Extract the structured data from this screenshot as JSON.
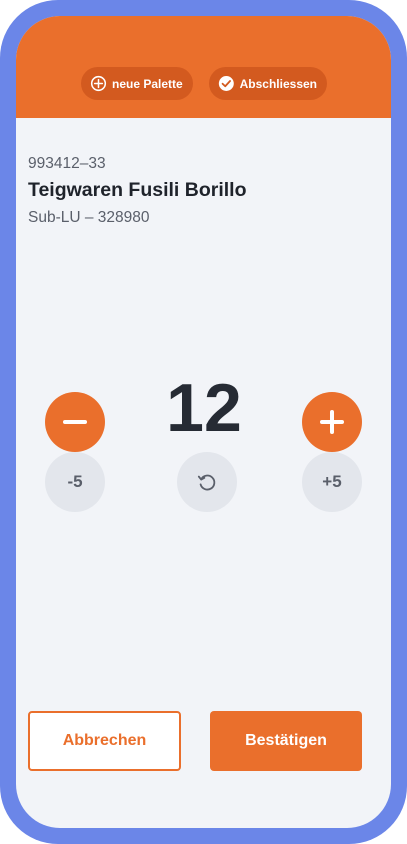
{
  "header": {
    "new_pallet_label": "neue Palette",
    "finish_label": "Abschliessen"
  },
  "article": {
    "code": "993412–33",
    "name": "Teigwaren Fusili Borillo",
    "sub_lu": "Sub-LU – 328980"
  },
  "counter": {
    "quantity": "12",
    "minus_five_label": "-5",
    "plus_five_label": "+5"
  },
  "actions": {
    "cancel_label": "Abbrechen",
    "confirm_label": "Bestätigen"
  },
  "icons": {
    "new_pallet": "plus-circle-icon",
    "finish": "check-circle-icon",
    "decrement": "minus-icon",
    "increment": "plus-icon",
    "reset": "reset-icon"
  },
  "colors": {
    "accent": "#ea6f2c",
    "frame": "#6b86e8",
    "background": "#f2f4f8"
  }
}
